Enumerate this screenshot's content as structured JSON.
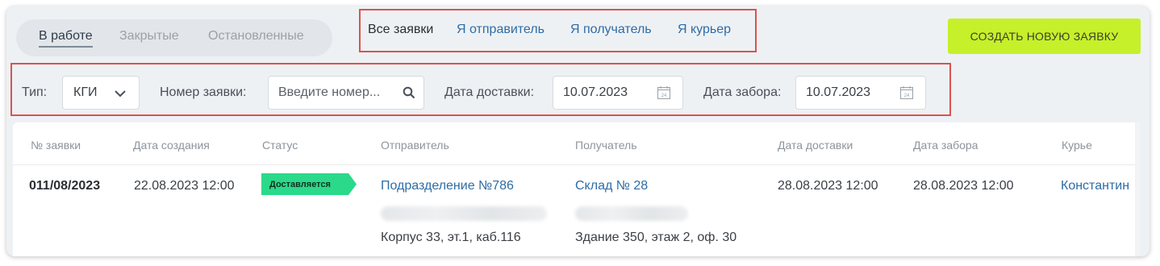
{
  "status_tabs": [
    {
      "label": "В работе",
      "active": true
    },
    {
      "label": "Закрытые",
      "active": false
    },
    {
      "label": "Остановленные",
      "active": false
    }
  ],
  "role_filters": [
    "Все заявки",
    "Я отправитель",
    "Я получатель",
    "Я курьер"
  ],
  "create_button": "СОЗДАТЬ НОВУЮ ЗАЯВКУ",
  "filters": {
    "type_label": "Тип:",
    "type_value": "КГИ",
    "number_label": "Номер заявки:",
    "number_placeholder": "Введите номер...",
    "delivery_label": "Дата доставки:",
    "delivery_value": "10.07.2023",
    "pickup_label": "Дата забора:",
    "pickup_value": "10.07.2023",
    "calendar_day": "24"
  },
  "table": {
    "headers": [
      "№ заявки",
      "Дата создания",
      "Статус",
      "Отправитель",
      "Получатель",
      "Дата доставки",
      "Дата забора",
      "Курье"
    ],
    "rows": [
      {
        "number": "011/08/2023",
        "created": "22.08.2023 12:00",
        "status": "Доставляется",
        "sender_name": "Подразделение №786",
        "sender_address": "Корпус 33, эт.1, каб.116",
        "receiver_name": "Склад № 28",
        "receiver_address": "Здание 350, этаж 2, оф. 30",
        "delivery_date": "28.08.2023 12:00",
        "pickup_date": "28.08.2023 12:00",
        "courier": "Константин"
      }
    ]
  },
  "colors": {
    "accent_link": "#2e6ca5",
    "create_button": "#c6f02a",
    "status_badge": "#2bd98b",
    "highlight_box": "#d9534f"
  }
}
